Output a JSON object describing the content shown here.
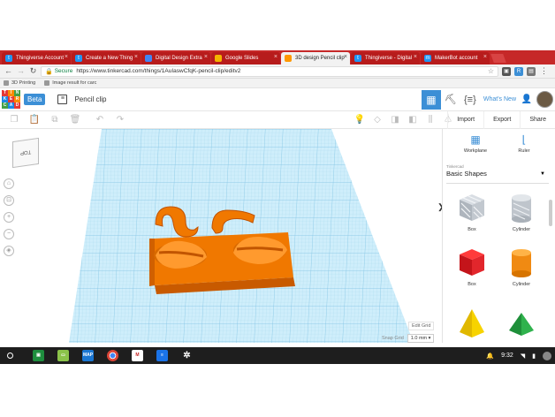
{
  "browser": {
    "tabs": [
      {
        "label": "Thingiverse Account",
        "icon_color": "#2196f3",
        "active": false
      },
      {
        "label": "Create a New Thing",
        "icon_color": "#2196f3",
        "active": false
      },
      {
        "label": "Digital Design Extra",
        "icon_color": "#4285f4",
        "active": false
      },
      {
        "label": "Google Slides",
        "icon_color": "#f4b400",
        "active": false
      },
      {
        "label": "3D design Pencil clip",
        "icon_color": "#ff9800",
        "active": true
      },
      {
        "label": "Thingiverse - Digital",
        "icon_color": "#2196f3",
        "active": false
      },
      {
        "label": "MakerBot account",
        "icon_color": "#2196f3",
        "active": false
      }
    ],
    "secure_label": "Secure",
    "url": "https://www.tinkercad.com/things/1AuIaswCfqK-pencil-clip/editv2",
    "bookmarks": [
      "3D Printing",
      "Image result for carc"
    ]
  },
  "tinkercad": {
    "logo_letters": [
      "TIN",
      "KER",
      "CAD"
    ],
    "beta_label": "Beta",
    "project_name": "Pencil clip",
    "whats_new": "What's New",
    "actions": [
      "Import",
      "Export",
      "Share"
    ],
    "viewcube_label": "TOP",
    "edit_grid_label": "Edit Grid",
    "snap_grid_label": "Snap Grid",
    "snap_grid_value": "1.0 mm",
    "panel": {
      "workplane_label": "Workplane",
      "ruler_label": "Ruler",
      "library_small": "Tinkercad",
      "library_name": "Basic Shapes",
      "shapes": [
        "Box",
        "Cylinder",
        "Box",
        "Cylinder"
      ]
    }
  },
  "shelf": {
    "time": "9:32",
    "apps": [
      {
        "name": "Classroom",
        "color": "#1e8e3e"
      },
      {
        "name": "Slides",
        "color": "#8bc34a"
      },
      {
        "name": "MAP",
        "color": "#1976d2"
      },
      {
        "name": "Chrome",
        "color": "#db4437"
      },
      {
        "name": "Gmail",
        "color": "#c62828"
      },
      {
        "name": "Docs",
        "color": "#1a73e8"
      }
    ]
  }
}
